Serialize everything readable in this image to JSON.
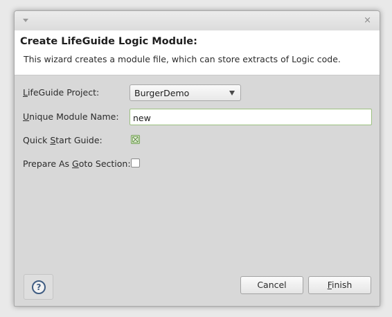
{
  "window": {
    "close_icon": "×"
  },
  "banner": {
    "title": "Create LifeGuide Logic Module:",
    "description": "This wizard creates a module file, which can store extracts of Logic code."
  },
  "form": {
    "project": {
      "label_mnemonic": "L",
      "label_rest": "ifeGuide Project:",
      "value": "BurgerDemo"
    },
    "module_name": {
      "label_mnemonic": "U",
      "label_rest": "nique Module Name:",
      "value": "new"
    },
    "quick_start": {
      "label_before": "Quick ",
      "label_mnemonic": "S",
      "label_after": "tart Guide:",
      "checked": true
    },
    "goto_section": {
      "label_before": "Prepare As ",
      "label_mnemonic": "G",
      "label_after": "oto Section:",
      "checked": false
    }
  },
  "buttons": {
    "help_glyph": "?",
    "cancel_label": "Cancel",
    "finish_mnemonic": "F",
    "finish_rest": "inish"
  },
  "colors": {
    "banner_bg": "#ffffff",
    "dialog_bg": "#d8d8d8",
    "focus_border": "#9bc07f",
    "check_accent": "#6a9a4a",
    "help_icon": "#3f5c82"
  },
  "icons": {
    "window_menu": "chevron-down-icon",
    "window_close": "close-icon",
    "combo_arrow": "dropdown-arrow-icon",
    "help": "help-icon"
  }
}
